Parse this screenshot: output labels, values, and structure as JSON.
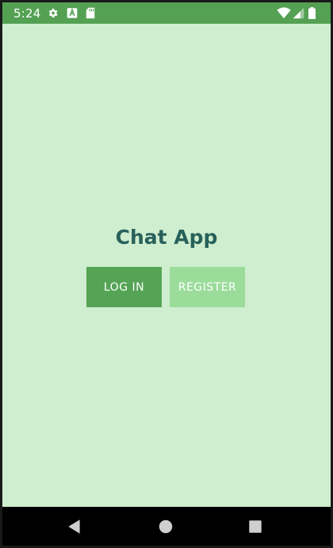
{
  "status_bar": {
    "time": "5:24",
    "icons": [
      "gear-icon",
      "a-icon",
      "sd-card-icon",
      "wifi-icon",
      "signal-icon",
      "battery-icon"
    ],
    "color": "#54a154"
  },
  "app": {
    "title": "Chat App",
    "background": "#cfeecf",
    "title_color": "#28615b"
  },
  "buttons": {
    "login_label": "LOG IN",
    "register_label": "REGISTER",
    "login_color": "#55a455",
    "register_color": "#9bdc9b"
  },
  "nav_bar": {
    "icons": [
      "back-icon",
      "home-icon",
      "recents-icon"
    ]
  }
}
